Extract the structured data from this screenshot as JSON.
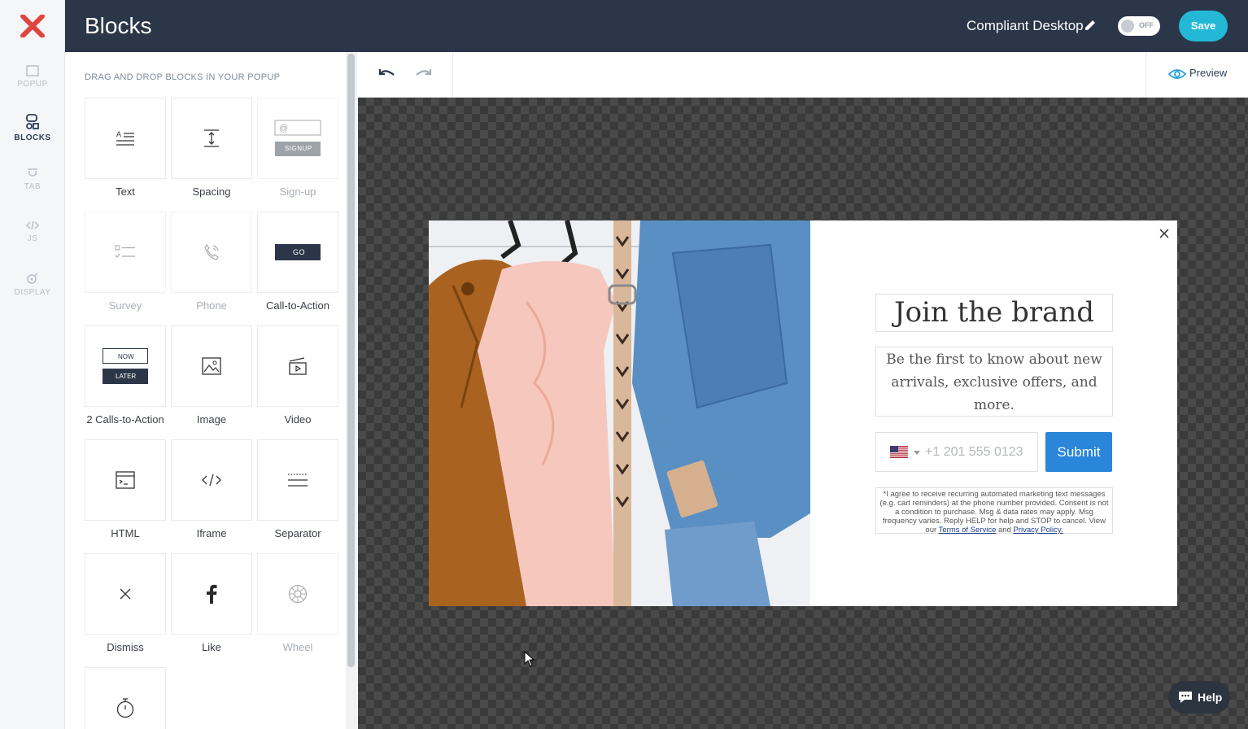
{
  "header": {
    "title": "Blocks",
    "popup_name": "Compliant Desktop",
    "toggle_label": "OFF",
    "save_label": "Save"
  },
  "rail": {
    "items": [
      {
        "label": "POPUP",
        "icon": "popup-icon",
        "active": false
      },
      {
        "label": "BLOCKS",
        "icon": "blocks-icon",
        "active": true
      },
      {
        "label": "TAB",
        "icon": "tab-icon",
        "active": false
      },
      {
        "label": "JS",
        "icon": "code-icon",
        "active": false
      },
      {
        "label": "DISPLAY",
        "icon": "display-icon",
        "active": false
      }
    ]
  },
  "panel": {
    "heading": "DRAG AND DROP BLOCKS IN YOUR POPUP",
    "blocks": [
      {
        "label": "Text",
        "enabled": true
      },
      {
        "label": "Spacing",
        "enabled": true
      },
      {
        "label": "Sign-up",
        "enabled": false,
        "icon_text_top": "@",
        "icon_text_bottom": "SIGNUP"
      },
      {
        "label": "Survey",
        "enabled": false
      },
      {
        "label": "Phone",
        "enabled": false
      },
      {
        "label": "Call-to-Action",
        "enabled": true,
        "icon_text": "GO"
      },
      {
        "label": "2 Calls-to-Action",
        "enabled": true,
        "icon_text_top": "NOW",
        "icon_text_bottom": "LATER"
      },
      {
        "label": "Image",
        "enabled": true
      },
      {
        "label": "Video",
        "enabled": true
      },
      {
        "label": "HTML",
        "enabled": true
      },
      {
        "label": "Iframe",
        "enabled": true
      },
      {
        "label": "Separator",
        "enabled": true
      },
      {
        "label": "Dismiss",
        "enabled": true
      },
      {
        "label": "Like",
        "enabled": true
      },
      {
        "label": "Wheel",
        "enabled": false
      },
      {
        "label": "",
        "enabled": true
      }
    ]
  },
  "toolbar": {
    "preview_label": "Preview"
  },
  "popup": {
    "headline": "Join the brand",
    "subtext": "Be the first to know about new arrivals, exclusive offers, and more.",
    "phone_placeholder": "+1 201 555 0123",
    "country": "US",
    "submit_label": "Submit",
    "legal_text": "*I agree to receive recurring automated marketing text messages (e.g. cart reminders) at the phone number provided. Consent is not a condition to purchase. Msg & data rates may apply. Msg frequency varies. Reply HELP for help and STOP to cancel. View our",
    "legal_and": "and",
    "terms_link": "Terms of Service",
    "privacy_link": "Privacy Policy."
  },
  "help": {
    "label": "Help"
  },
  "colors": {
    "header_bg": "#2b3648",
    "save_bg": "#23b9d6",
    "submit_bg": "#2a86d8",
    "brand_red": "#e0443e"
  }
}
